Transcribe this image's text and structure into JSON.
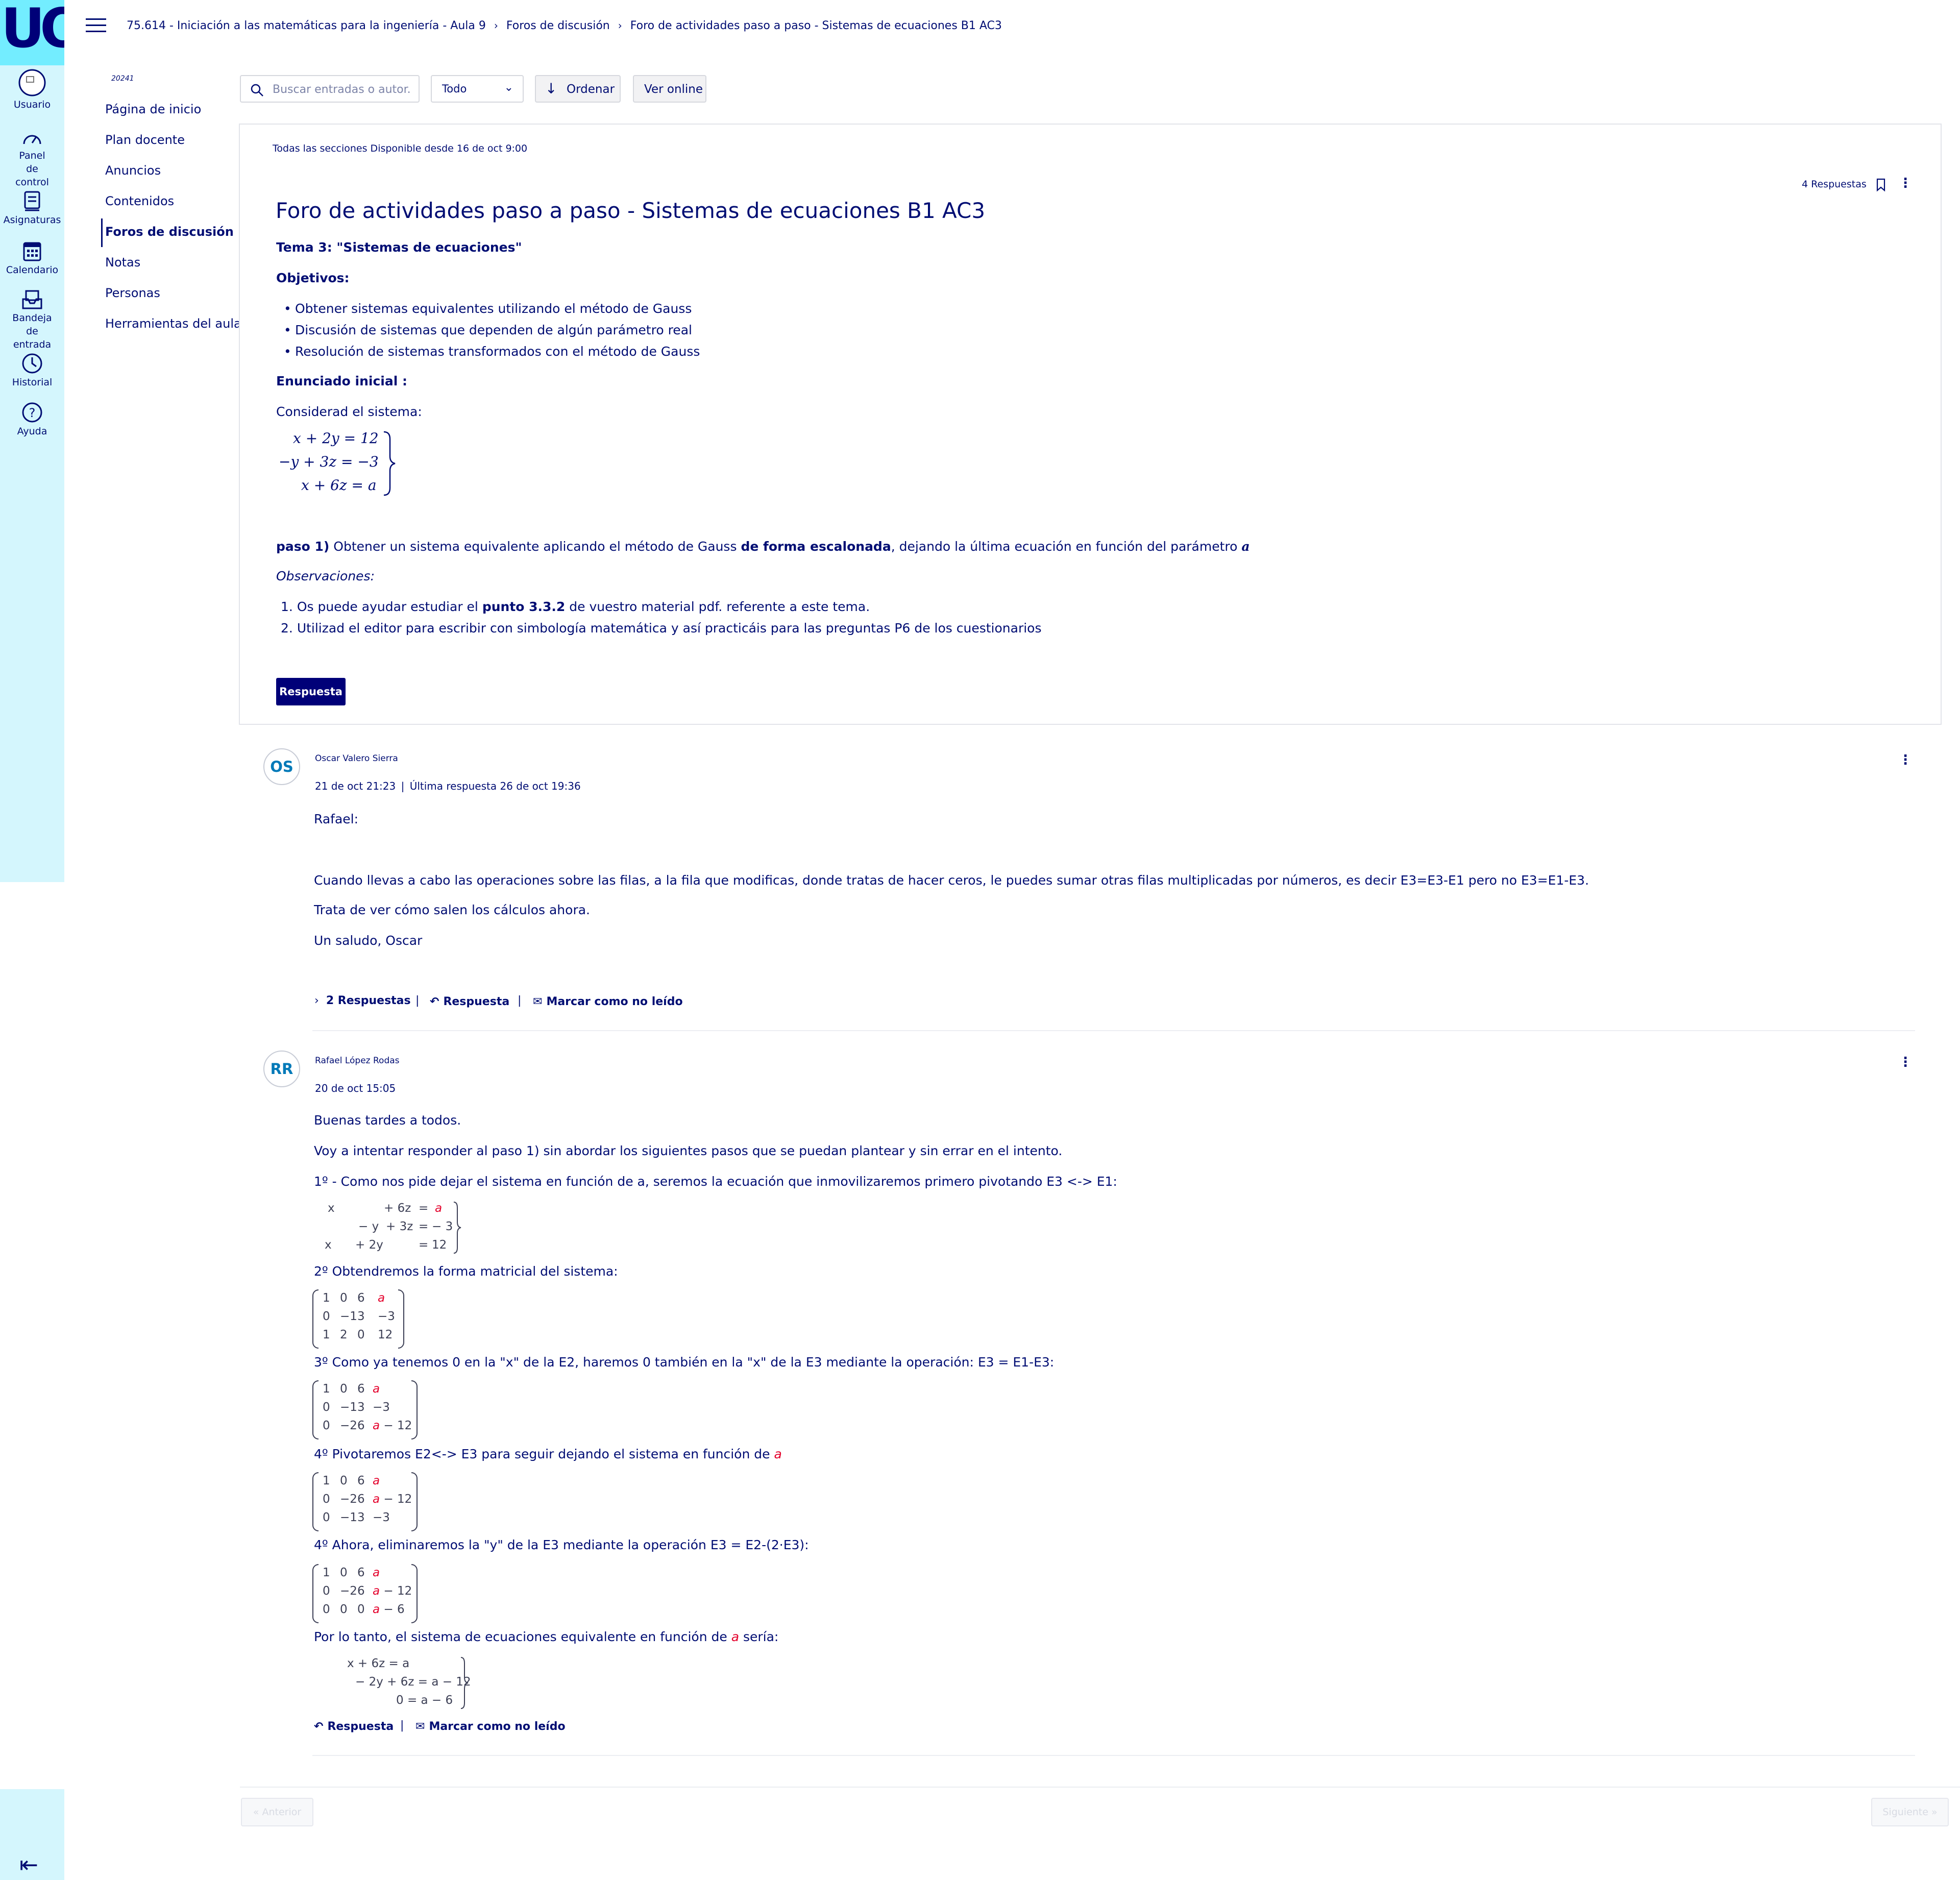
{
  "rail": {
    "logo": "UOC",
    "items": [
      {
        "label": "Usuario"
      },
      {
        "label": "Panel de control"
      },
      {
        "label": "Asignaturas"
      },
      {
        "label": "Calendario"
      },
      {
        "label": "Bandeja de entrada"
      },
      {
        "label": "Historial"
      },
      {
        "label": "Ayuda"
      }
    ]
  },
  "breadcrumb": [
    "75.614 - Iniciación a las matemáticas para la ingeniería - Aula 9",
    "Foros de discusión",
    "Foro de actividades paso a paso - Sistemas de ecuaciones B1 AC3"
  ],
  "sidebar": {
    "semester": "20241",
    "items": [
      "Página de inicio",
      "Plan docente",
      "Anuncios",
      "Contenidos",
      "Foros de discusión",
      "Notas",
      "Personas",
      "Herramientas del aula"
    ]
  },
  "toolbar": {
    "search_placeholder": "Buscar entradas o autor...",
    "filter_value": "Todo",
    "sort_label": "Ordenar",
    "online_label": "Ver online"
  },
  "topic": {
    "availability": "Todas las secciones Disponible desde 16 de oct 9:00",
    "replies": "4 Respuestas",
    "title": "Foro de actividades paso a paso - Sistemas de ecuaciones B1 AC3",
    "tema": "Tema 3: \"Sistemas de ecuaciones\"",
    "objetivos_heading": "Objetivos:",
    "objetivos": [
      "Obtener sistemas equivalentes utilizando el método de Gauss",
      "Discusión de sistemas que dependen de algún parámetro real",
      "Resolución de sistemas transformados con el método de Gauss"
    ],
    "enunciado_heading": "Enunciado inicial :",
    "considerad": "Considerad el sistema:",
    "system": [
      "x + 2y = 12",
      "−y + 3z = −3",
      "x + 6z = a"
    ],
    "paso_label": "paso 1)",
    "paso_text1": " Obtener un sistema equivalente aplicando el método de Gauss ",
    "paso_bold": "de forma escalonada",
    "paso_text2": ", dejando la última ecuación en función del parámetro ",
    "paso_param": "a",
    "observaciones": "Observaciones:",
    "obs1_a": "Os puede ayudar estudiar el ",
    "obs1_b": "punto 3.3.2",
    "obs1_c": " de vuestro material pdf. referente a este tema.",
    "obs2": "Utilizad el editor para escribir con simbología matemática y así practicáis para las preguntas P6 de los cuestionarios",
    "reply_button": "Respuesta"
  },
  "post1": {
    "initials": "OS",
    "author": "Oscar Valero Sierra",
    "date": "21 de oct 21:23",
    "last_reply": "Última respuesta 26 de oct 19:36",
    "lines": [
      "Rafael:",
      "Cuando llevas a cabo las operaciones sobre las filas, a la fila que modificas, donde tratas de hacer ceros, le puedes sumar otras filas multiplicadas por números, es decir E3=E3-E1 pero no E3=E1-E3.",
      "Trata de ver cómo salen los cálculos ahora.",
      "Un saludo, Oscar"
    ],
    "replies_toggle": "2 Respuestas",
    "reply": "Respuesta",
    "mark_unread": "Marcar como no leído"
  },
  "post2": {
    "initials": "RR",
    "author": "Rafael López Rodas",
    "date": "20 de oct 15:05",
    "greeting": "Buenas tardes a todos.",
    "intro": "Voy a intentar responder al paso 1) sin abordar los siguientes pasos que se puedan plantear y sin errar en el intento.",
    "step1": "1º - Como nos pide dejar el sistema en función de a, seremos la ecuación que inmovilizaremos primero pivotando E3 <-> E1:",
    "step2": "2º Obtendremos la forma matricial del sistema:",
    "step3": "3º Como ya tenemos 0 en la \"x\" de la E2, haremos 0 también en la \"x\" de la E3 mediante la operación:   E3 = E1-E3:",
    "step4a": "4º Pivotaremos E2<-> E3 para seguir dejando el sistema en función de ",
    "step4b": "4º Ahora, eliminaremos la \"y\" de la E3 mediante la operación  E3 = E2-(2·E3):",
    "conclusion_a": "Por lo tanto, el sistema de ecuaciones equivalente en función de ",
    "conclusion_b": " sería:",
    "param": "a",
    "sys1": {
      "r1": [
        "x",
        "+ 6z",
        "=",
        "a"
      ],
      "r2": [
        "− y",
        "+ 3z",
        "=",
        "− 3"
      ],
      "r3": [
        "x",
        "+ 2y",
        "=",
        "12"
      ]
    },
    "m1": [
      [
        "1",
        "0",
        "6",
        "a"
      ],
      [
        "0",
        "−1",
        "3",
        "−3"
      ],
      [
        "1",
        "2",
        "0",
        "12"
      ]
    ],
    "m2": [
      [
        "1",
        "0",
        "6",
        "a"
      ],
      [
        "0",
        "−1",
        "3",
        "−3"
      ],
      [
        "0",
        "−2",
        "6",
        "a − 12"
      ]
    ],
    "m3": [
      [
        "1",
        "0",
        "6",
        "a"
      ],
      [
        "0",
        "−2",
        "6",
        "a − 12"
      ],
      [
        "0",
        "−1",
        "3",
        "−3"
      ]
    ],
    "m4": [
      [
        "1",
        "0",
        "6",
        "a"
      ],
      [
        "0",
        "−2",
        "6",
        "a − 12"
      ],
      [
        "0",
        "0",
        "0",
        "a − 6"
      ]
    ],
    "final": [
      "x        + 6z = a",
      "− 2y + 6z = a − 12",
      "0 = a − 6"
    ],
    "reply": "Respuesta",
    "mark_unread": "Marcar como no leído"
  },
  "pager": {
    "prev": "« Anterior",
    "next": "Siguiente »"
  }
}
